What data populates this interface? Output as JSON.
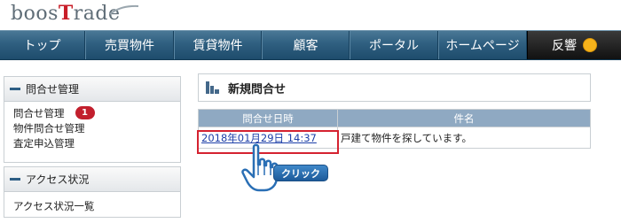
{
  "brand": {
    "part1": "boos",
    "part2": "T",
    "part3": "rade"
  },
  "nav": [
    {
      "label": "トップ"
    },
    {
      "label": "売買物件"
    },
    {
      "label": "賃貸物件"
    },
    {
      "label": "顧客"
    },
    {
      "label": "ポータル"
    },
    {
      "label": "ホームページ"
    },
    {
      "label": "反響"
    }
  ],
  "sidebar": {
    "inquiry": {
      "heading": "問合せ管理",
      "items": [
        {
          "label": "問合せ管理",
          "count": "1"
        },
        {
          "label": "物件問合せ管理"
        },
        {
          "label": "査定申込管理"
        }
      ]
    },
    "access": {
      "heading": "アクセス状況",
      "items": [
        {
          "label": "アクセス状況一覧"
        }
      ]
    }
  },
  "main": {
    "title": "新規問合せ",
    "columns": [
      "問合せ日時",
      "件名"
    ],
    "rows": [
      {
        "date": "2018年01月29日 14:37",
        "subject": "戸建て物件を探しています。"
      }
    ]
  },
  "annotation": {
    "click_label": "クリック"
  },
  "colors": {
    "nav": "#2f5f80",
    "accent_red": "#c21f2d",
    "highlight": "#d52230",
    "table_header": "#8fa9c2"
  }
}
